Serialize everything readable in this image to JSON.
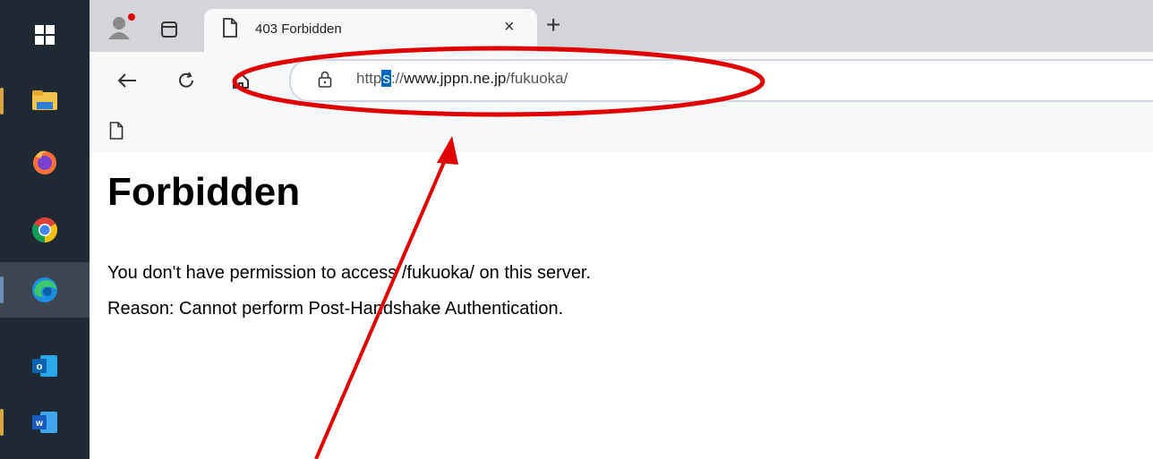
{
  "taskbar": {
    "items": [
      {
        "name": "windows-start-icon"
      },
      {
        "name": "file-explorer-icon"
      },
      {
        "name": "firefox-icon"
      },
      {
        "name": "chrome-icon"
      },
      {
        "name": "edge-icon"
      },
      {
        "name": "outlook-icon",
        "letter": "o"
      },
      {
        "name": "word-icon",
        "letter": "w"
      }
    ]
  },
  "browser": {
    "tab": {
      "title": "403 Forbidden",
      "close": "×"
    },
    "new_tab": "+",
    "address": {
      "scheme_before": "http",
      "selected": "s",
      "after": "://",
      "domain": "www.jppn.ne.jp",
      "path": "/fukuoka/"
    }
  },
  "page": {
    "heading": "Forbidden",
    "line1": "You don't have permission to access /fukuoka/ on this server.",
    "line2": "Reason: Cannot perform Post-Handshake Authentication."
  },
  "colors": {
    "annotation": "#e00000",
    "selection": "#0067c0",
    "taskbar": "#1f2933"
  }
}
